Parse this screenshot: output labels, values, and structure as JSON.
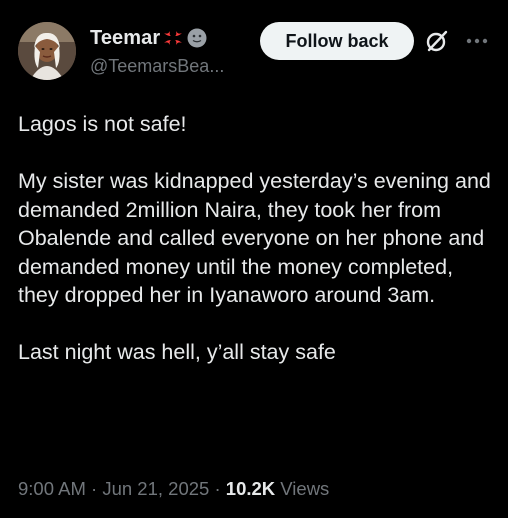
{
  "author": {
    "display_name": "Teemar",
    "handle": "@TeemarsBea...",
    "emojis": [
      "anger-symbol-icon",
      "smiley-face-icon"
    ]
  },
  "actions": {
    "follow_label": "Follow back",
    "grok_icon": "grok-icon",
    "more_icon": "more-options-icon"
  },
  "tweet": {
    "paragraphs": [
      "Lagos is not safe!",
      "My sister was kidnapped yesterday’s evening and demanded 2million Naira, they took her from Obalende and called everyone on her phone and demanded money until the money completed, they dropped her in Iyanaworo around 3am.",
      "Last night was hell, y’all stay safe"
    ]
  },
  "meta": {
    "time": "9:00 AM",
    "separator": "·",
    "date": "Jun 21, 2025",
    "views_count": "10.2K",
    "views_label": "Views"
  },
  "colors": {
    "background": "#000000",
    "text_primary": "#e7e9ea",
    "text_secondary": "#71767b",
    "button_bg": "#eff3f4",
    "button_text": "#0f1419",
    "anger_emoji": "#ff3b3b"
  }
}
